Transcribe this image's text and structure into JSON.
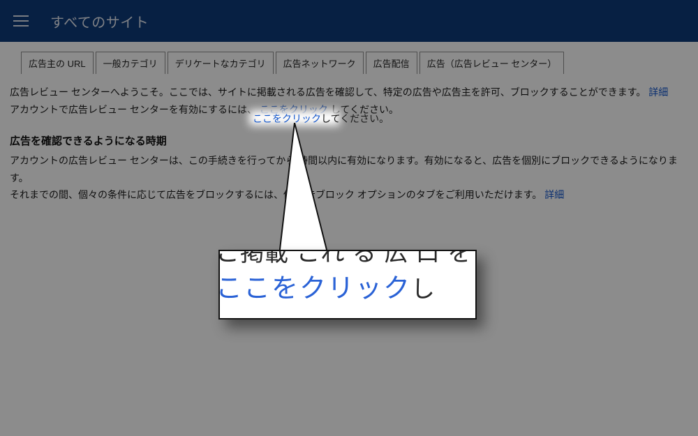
{
  "header": {
    "title": "すべてのサイト"
  },
  "tabs": [
    {
      "label": "広告主の URL"
    },
    {
      "label": "一般カテゴリ"
    },
    {
      "label": "デリケートなカテゴリ"
    },
    {
      "label": "広告ネットワーク"
    },
    {
      "label": "広告配信"
    },
    {
      "label": "広告（広告レビュー センター）"
    }
  ],
  "intro": {
    "line1_a": "広告レビュー センターへようこそ。ここでは、サイトに掲載される広告を確認して、特定の広告や広告主を許可、ブロックすることができます。",
    "line1_link": "詳細",
    "line2_a": "アカウントで広告レビュー センターを有効にするには、",
    "line2_link": "ここをクリック",
    "line2_b": "してください。"
  },
  "section": {
    "heading": "広告を確認できるようになる時期",
    "body_a": "アカウントの広告レビュー センターは、この手続きを行ってから    時間以内に有効になります。有効になると、広告を個別にブロックできるようになります。",
    "body_b": "それまでの間、個々の条件に応じて広告をブロックするには、他の   告ブロック オプションのタブをご利用いただけます。",
    "body_b_link": "詳細"
  },
  "callout": {
    "top_fragment": "こ掲載 これ る 広 口 を",
    "link_text": "ここをクリック",
    "tail": "し"
  }
}
